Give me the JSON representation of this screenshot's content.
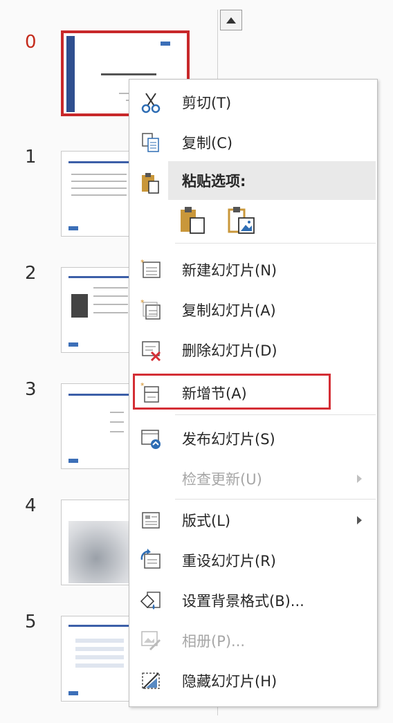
{
  "slides": [
    {
      "number": "0",
      "selected": true
    },
    {
      "number": "1",
      "selected": false
    },
    {
      "number": "2",
      "selected": false
    },
    {
      "number": "3",
      "selected": false
    },
    {
      "number": "4",
      "selected": false
    },
    {
      "number": "5",
      "selected": false
    }
  ],
  "context_menu": {
    "cut": "剪切(T)",
    "copy": "复制(C)",
    "paste_options": "粘贴选项:",
    "new_slide": "新建幻灯片(N)",
    "duplicate_slide": "复制幻灯片(A)",
    "delete_slide": "删除幻灯片(D)",
    "add_section": "新增节(A)",
    "publish_slides": "发布幻灯片(S)",
    "check_updates": "检查更新(U)",
    "layout": "版式(L)",
    "reset_slide": "重设幻灯片(R)",
    "format_background": "设置背景格式(B)...",
    "photo_album": "相册(P)...",
    "hide_slide": "隐藏幻灯片(H)"
  },
  "colors": {
    "selection_red": "#c8282a",
    "highlight_red": "#d42e35",
    "icon_blue": "#2e6db4",
    "icon_gold": "#c9973a"
  }
}
